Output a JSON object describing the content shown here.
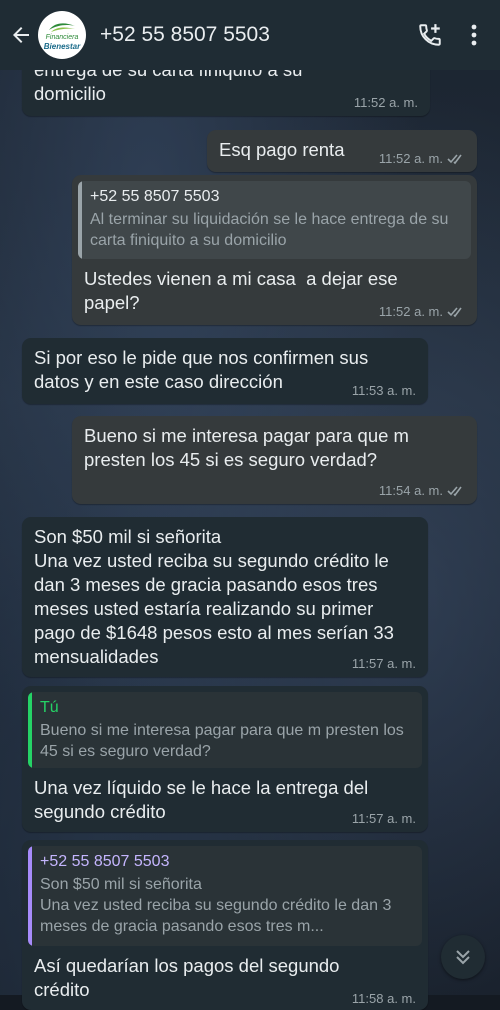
{
  "header": {
    "contact": "+52 55 8507 5503",
    "logo_top": "Financiera",
    "logo_bottom": "Bienestar"
  },
  "messages": [
    {
      "text": "entrega de su carta finiquito a su\ndomicilio",
      "time": "11:52 a. m."
    },
    {
      "text": "Esq pago renta",
      "time": "11:52 a. m."
    },
    {
      "quote_name": "+52 55 8507 5503",
      "quote_text": "Al terminar su liquidación se le hace entrega de su carta finiquito a su domicilio",
      "text": "Ustedes vienen a mi casa  a dejar ese papel?",
      "time": "11:52 a. m."
    },
    {
      "text": "Si por eso le pide que nos confirmen sus datos y en este caso dirección",
      "time": "11:53 a. m."
    },
    {
      "text": "Bueno si me interesa pagar para que m presten los 45 si es seguro verdad?",
      "time": "11:54 a. m."
    },
    {
      "text": "Son $50 mil si señorita\nUna vez usted reciba su segundo crédito le dan 3 meses de gracia pasando esos tres meses usted estaría realizando su primer pago de $1648 pesos esto al mes serían 33 mensualidades",
      "time": "11:57 a. m."
    },
    {
      "quote_name": "Tú",
      "quote_text": "Bueno si me interesa pagar para que m presten los 45 si es seguro verdad?",
      "text": "Una vez líquido se le hace la entrega del segundo crédito",
      "time": "11:57 a. m."
    },
    {
      "quote_name": "+52 55 8507 5503",
      "quote_text": "Son $50 mil si señorita\nUna vez usted reciba su segundo crédito le dan 3 meses de gracia pasando esos tres m...",
      "text": "Así quedarían los pagos del segundo crédito",
      "time": "11:58 a. m."
    }
  ],
  "colors": {
    "header_bg": "#1f2c34",
    "incoming_bubble": "#202c33",
    "outgoing_bubble": "#353a3c",
    "quote_contact": "#a78bfa",
    "quote_self": "#25d366"
  }
}
